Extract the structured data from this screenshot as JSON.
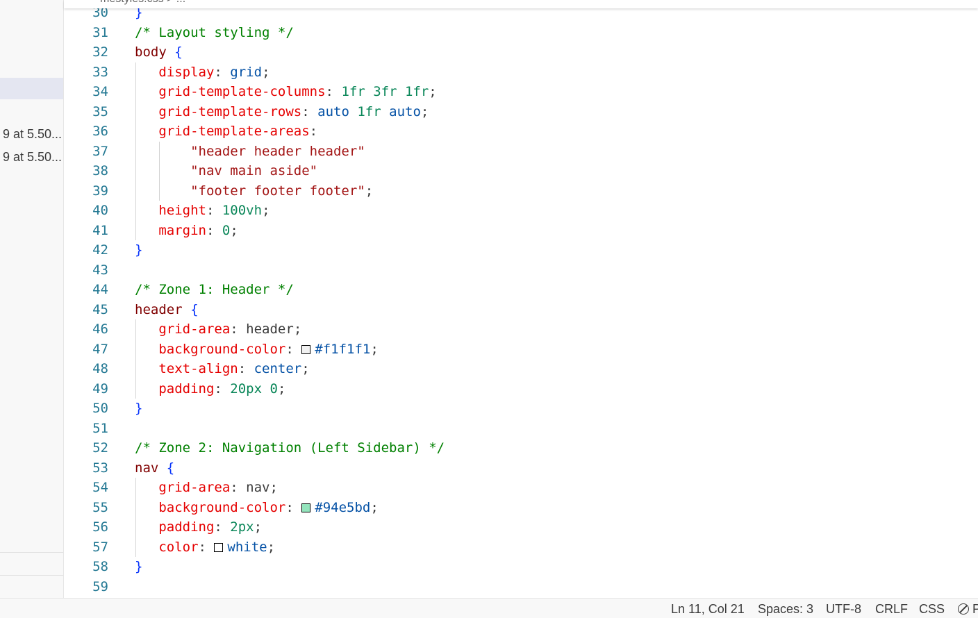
{
  "breadcrumb": "mestyles.css > ...",
  "sidebar": {
    "files": [
      "9 at 5.50...",
      "9 at 5.50..."
    ]
  },
  "editor": {
    "lines": [
      {
        "n": "30",
        "tokens": [
          {
            "t": "}",
            "c": "b"
          }
        ]
      },
      {
        "n": "31",
        "tokens": [
          {
            "t": "/* Layout styling */",
            "c": "c"
          }
        ]
      },
      {
        "n": "32",
        "tokens": [
          {
            "t": "body",
            "c": "s"
          },
          {
            "t": " ",
            "c": "t"
          },
          {
            "t": "{",
            "c": "b"
          }
        ]
      },
      {
        "n": "33",
        "tokens": [
          {
            "t": "   ",
            "c": "t"
          },
          {
            "t": "display",
            "c": "p"
          },
          {
            "t": ": ",
            "c": "t"
          },
          {
            "t": "grid",
            "c": "v"
          },
          {
            "t": ";",
            "c": "t"
          }
        ]
      },
      {
        "n": "34",
        "tokens": [
          {
            "t": "   ",
            "c": "t"
          },
          {
            "t": "grid-template-columns",
            "c": "p"
          },
          {
            "t": ": ",
            "c": "t"
          },
          {
            "t": "1fr 3fr 1fr",
            "c": "n"
          },
          {
            "t": ";",
            "c": "t"
          }
        ]
      },
      {
        "n": "35",
        "tokens": [
          {
            "t": "   ",
            "c": "t"
          },
          {
            "t": "grid-template-rows",
            "c": "p"
          },
          {
            "t": ": ",
            "c": "t"
          },
          {
            "t": "auto",
            "c": "v"
          },
          {
            "t": " ",
            "c": "t"
          },
          {
            "t": "1fr",
            "c": "n"
          },
          {
            "t": " ",
            "c": "t"
          },
          {
            "t": "auto",
            "c": "v"
          },
          {
            "t": ";",
            "c": "t"
          }
        ]
      },
      {
        "n": "36",
        "tokens": [
          {
            "t": "   ",
            "c": "t"
          },
          {
            "t": "grid-template-areas",
            "c": "p"
          },
          {
            "t": ":",
            "c": "t"
          }
        ]
      },
      {
        "n": "37",
        "tokens": [
          {
            "t": "       ",
            "c": "t"
          },
          {
            "t": "\"header header header\"",
            "c": "str"
          }
        ]
      },
      {
        "n": "38",
        "tokens": [
          {
            "t": "       ",
            "c": "t"
          },
          {
            "t": "\"nav main aside\"",
            "c": "str"
          }
        ]
      },
      {
        "n": "39",
        "tokens": [
          {
            "t": "       ",
            "c": "t"
          },
          {
            "t": "\"footer footer footer\"",
            "c": "str"
          },
          {
            "t": ";",
            "c": "t"
          }
        ]
      },
      {
        "n": "40",
        "tokens": [
          {
            "t": "   ",
            "c": "t"
          },
          {
            "t": "height",
            "c": "p"
          },
          {
            "t": ": ",
            "c": "t"
          },
          {
            "t": "100vh",
            "c": "n"
          },
          {
            "t": ";",
            "c": "t"
          }
        ]
      },
      {
        "n": "41",
        "tokens": [
          {
            "t": "   ",
            "c": "t"
          },
          {
            "t": "margin",
            "c": "p"
          },
          {
            "t": ": ",
            "c": "t"
          },
          {
            "t": "0",
            "c": "n"
          },
          {
            "t": ";",
            "c": "t"
          }
        ]
      },
      {
        "n": "42",
        "tokens": [
          {
            "t": "}",
            "c": "b"
          }
        ]
      },
      {
        "n": "43",
        "tokens": []
      },
      {
        "n": "44",
        "tokens": [
          {
            "t": "/* Zone 1: Header */",
            "c": "c"
          }
        ]
      },
      {
        "n": "45",
        "tokens": [
          {
            "t": "header",
            "c": "s"
          },
          {
            "t": " ",
            "c": "t"
          },
          {
            "t": "{",
            "c": "b"
          }
        ]
      },
      {
        "n": "46",
        "tokens": [
          {
            "t": "   ",
            "c": "t"
          },
          {
            "t": "grid-area",
            "c": "p"
          },
          {
            "t": ": ",
            "c": "t"
          },
          {
            "t": "header",
            "c": "t"
          },
          {
            "t": ";",
            "c": "t"
          }
        ]
      },
      {
        "n": "47",
        "tokens": [
          {
            "t": "   ",
            "c": "t"
          },
          {
            "t": "background-color",
            "c": "p"
          },
          {
            "t": ": ",
            "c": "t"
          },
          {
            "t": "",
            "c": "swatch",
            "color": "#f1f1f1"
          },
          {
            "t": "#f1f1f1",
            "c": "v"
          },
          {
            "t": ";",
            "c": "t"
          }
        ]
      },
      {
        "n": "48",
        "tokens": [
          {
            "t": "   ",
            "c": "t"
          },
          {
            "t": "text-align",
            "c": "p"
          },
          {
            "t": ": ",
            "c": "t"
          },
          {
            "t": "center",
            "c": "v"
          },
          {
            "t": ";",
            "c": "t"
          }
        ]
      },
      {
        "n": "49",
        "tokens": [
          {
            "t": "   ",
            "c": "t"
          },
          {
            "t": "padding",
            "c": "p"
          },
          {
            "t": ": ",
            "c": "t"
          },
          {
            "t": "20px 0",
            "c": "n"
          },
          {
            "t": ";",
            "c": "t"
          }
        ]
      },
      {
        "n": "50",
        "tokens": [
          {
            "t": "}",
            "c": "b"
          }
        ]
      },
      {
        "n": "51",
        "tokens": []
      },
      {
        "n": "52",
        "tokens": [
          {
            "t": "/* Zone 2: Navigation (Left Sidebar) */",
            "c": "c"
          }
        ]
      },
      {
        "n": "53",
        "tokens": [
          {
            "t": "nav",
            "c": "s"
          },
          {
            "t": " ",
            "c": "t"
          },
          {
            "t": "{",
            "c": "b"
          }
        ]
      },
      {
        "n": "54",
        "tokens": [
          {
            "t": "   ",
            "c": "t"
          },
          {
            "t": "grid-area",
            "c": "p"
          },
          {
            "t": ": ",
            "c": "t"
          },
          {
            "t": "nav",
            "c": "t"
          },
          {
            "t": ";",
            "c": "t"
          }
        ]
      },
      {
        "n": "55",
        "tokens": [
          {
            "t": "   ",
            "c": "t"
          },
          {
            "t": "background-color",
            "c": "p"
          },
          {
            "t": ": ",
            "c": "t"
          },
          {
            "t": "",
            "c": "swatch",
            "color": "#94e5bd"
          },
          {
            "t": "#94e5bd",
            "c": "v"
          },
          {
            "t": ";",
            "c": "t"
          }
        ]
      },
      {
        "n": "56",
        "tokens": [
          {
            "t": "   ",
            "c": "t"
          },
          {
            "t": "padding",
            "c": "p"
          },
          {
            "t": ": ",
            "c": "t"
          },
          {
            "t": "2px",
            "c": "n"
          },
          {
            "t": ";",
            "c": "t"
          }
        ]
      },
      {
        "n": "57",
        "tokens": [
          {
            "t": "   ",
            "c": "t"
          },
          {
            "t": "color",
            "c": "p"
          },
          {
            "t": ": ",
            "c": "t"
          },
          {
            "t": "",
            "c": "swatch",
            "color": "#ffffff"
          },
          {
            "t": "white",
            "c": "v"
          },
          {
            "t": ";",
            "c": "t"
          }
        ]
      },
      {
        "n": "58",
        "tokens": [
          {
            "t": "}",
            "c": "b"
          }
        ]
      },
      {
        "n": "59",
        "tokens": []
      }
    ]
  },
  "statusbar": {
    "position": "Ln 11, Col 21",
    "spaces": "Spaces: 3",
    "encoding": "UTF-8",
    "eol": "CRLF",
    "language": "CSS",
    "trailing": "P"
  },
  "colors": {
    "comment": "#008000",
    "selector": "#800000",
    "brace": "#0431fa",
    "property": "#e50000",
    "value": "#0451a5",
    "number": "#098658",
    "string": "#a31515",
    "line_number": "#237893"
  }
}
